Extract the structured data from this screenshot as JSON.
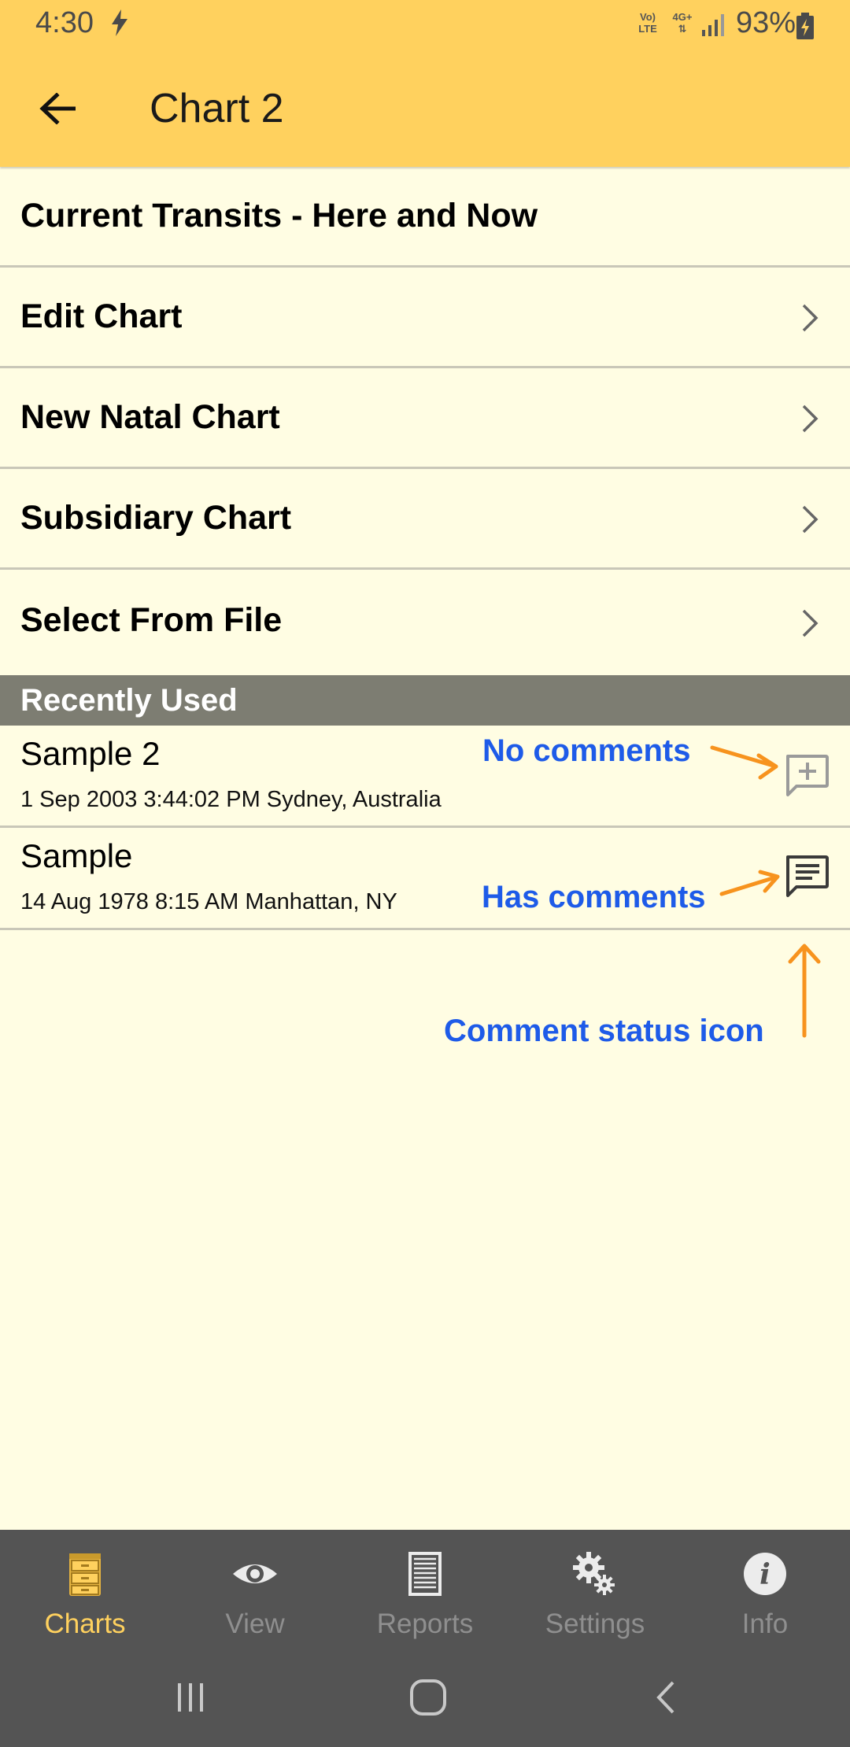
{
  "status_bar": {
    "time": "4:30",
    "network_top": "Vo)",
    "network_bottom": "LTE",
    "data_top": "4G+",
    "battery": "93%"
  },
  "app_bar": {
    "title": "Chart 2",
    "back_icon": "arrow-left-icon"
  },
  "menu": {
    "items": [
      {
        "label": "Current Transits - Here and Now",
        "chevron": false
      },
      {
        "label": "Edit Chart",
        "chevron": true
      },
      {
        "label": "New Natal Chart",
        "chevron": true
      },
      {
        "label": "Subsidiary Chart",
        "chevron": true
      },
      {
        "label": "Select From File",
        "chevron": true
      }
    ]
  },
  "recently_used": {
    "header": "Recently Used",
    "items": [
      {
        "name": "Sample 2",
        "detail": "1 Sep 2003 3:44:02 PM Sydney, Australia",
        "comment_icon": "comment-add-icon"
      },
      {
        "name": "Sample",
        "detail": "14 Aug 1978 8:15 AM Manhattan, NY",
        "comment_icon": "comment-icon"
      }
    ]
  },
  "annotations": {
    "no_comments": "No comments",
    "has_comments": "Has comments",
    "comment_status": "Comment status icon"
  },
  "bottom_nav": {
    "items": [
      {
        "label": "Charts",
        "icon": "file-cabinet-icon",
        "active": true
      },
      {
        "label": "View",
        "icon": "eye-icon",
        "active": false
      },
      {
        "label": "Reports",
        "icon": "document-icon",
        "active": false
      },
      {
        "label": "Settings",
        "icon": "gear-icon",
        "active": false
      },
      {
        "label": "Info",
        "icon": "info-icon",
        "active": false
      }
    ]
  },
  "colors": {
    "accent": "#ffd15e",
    "background": "#fffde3",
    "section_header": "#7d7d72",
    "annotation_text": "#1e5be8",
    "annotation_arrow": "#f7931e",
    "nav_background": "#545454"
  }
}
